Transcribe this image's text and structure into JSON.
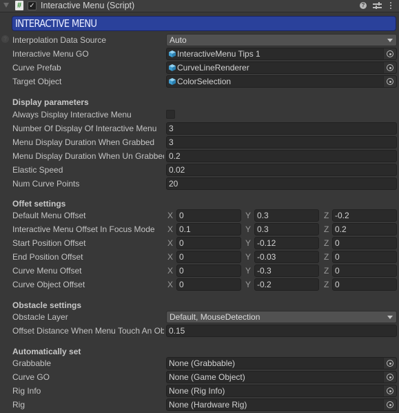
{
  "component": {
    "title": "Interactive Menu (Script)",
    "enabled": true,
    "icons": [
      "foldout-arrow-icon",
      "script-icon",
      "help-icon",
      "preset-icon",
      "context-menu-icon"
    ]
  },
  "banner": {
    "title": "INTERACTIVE MENU"
  },
  "general": {
    "interpolation": {
      "label": "Interpolation Data Source",
      "value": "Auto"
    },
    "object_fields": [
      {
        "label": "Interactive Menu GO",
        "value": "InteractiveMenu Tips 1"
      },
      {
        "label": "Curve Prefab",
        "value": "CurveLineRenderer"
      },
      {
        "label": "Target Object",
        "value": "ColorSelection"
      }
    ]
  },
  "display": {
    "header": "Display parameters",
    "always_display": {
      "label": "Always Display Interactive Menu",
      "checked": false
    },
    "fields": [
      {
        "label": "Number Of Display Of Interactive Menu",
        "value": "3"
      },
      {
        "label": "Menu Display Duration When Grabbed",
        "value": "3"
      },
      {
        "label": "Menu Display Duration When Un Grabbed",
        "value": "0.2"
      },
      {
        "label": "Elastic Speed",
        "value": "0.02"
      },
      {
        "label": "Num Curve Points",
        "value": "20"
      }
    ]
  },
  "offset": {
    "header": "Offet settings",
    "axes": [
      "X",
      "Y",
      "Z"
    ],
    "vectors": [
      {
        "label": "Default Menu Offset",
        "x": "0",
        "y": "0.3",
        "z": "-0.2"
      },
      {
        "label": "Interactive Menu Offset In Focus Mode",
        "x": "0.1",
        "y": "0.3",
        "z": "0.2"
      },
      {
        "label": "Start Position Offset",
        "x": "0",
        "y": "-0.12",
        "z": "0"
      },
      {
        "label": "End Position Offset",
        "x": "0",
        "y": "-0.03",
        "z": "0"
      },
      {
        "label": "Curve Menu Offset",
        "x": "0",
        "y": "-0.3",
        "z": "0"
      },
      {
        "label": "Curve Object Offset",
        "x": "0",
        "y": "-0.2",
        "z": "0"
      }
    ]
  },
  "obstacle": {
    "header": "Obstacle settings",
    "layer": {
      "label": "Obstacle Layer",
      "value": "Default, MouseDetection"
    },
    "distance": {
      "label": "Offset Distance When Menu Touch An Obstacle",
      "value": "0.15"
    }
  },
  "auto": {
    "header": "Automatically set",
    "fields": [
      {
        "label": "Grabbable",
        "value": "None (Grabbable)"
      },
      {
        "label": "Curve GO",
        "value": "None (Game Object)"
      },
      {
        "label": "Rig Info",
        "value": "None (Rig Info)"
      },
      {
        "label": "Rig",
        "value": "None (Hardware Rig)"
      }
    ]
  },
  "colors": {
    "banner": "#2a419b",
    "background": "#383838",
    "field": "#2a2a2a"
  }
}
